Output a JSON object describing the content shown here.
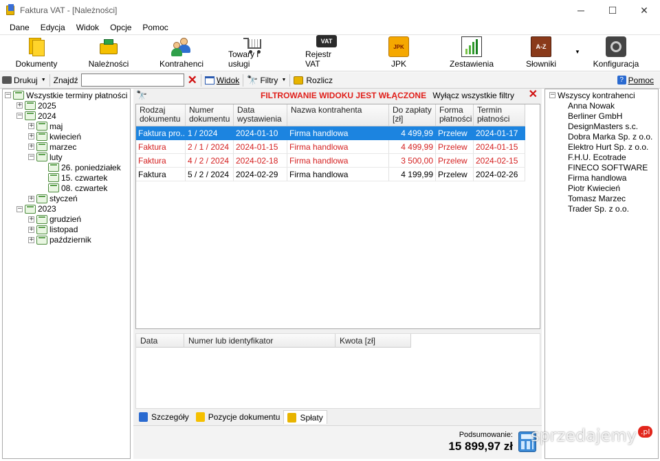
{
  "window": {
    "title": "Faktura VAT - [Należności]",
    "minimize": "─",
    "maximize": "☐",
    "close": "✕"
  },
  "menu": [
    {
      "label": "Dane"
    },
    {
      "label": "Edycja"
    },
    {
      "label": "Widok"
    },
    {
      "label": "Opcje"
    },
    {
      "label": "Pomoc"
    }
  ],
  "ribbon": [
    {
      "label": "Dokumenty",
      "icon": "documents-icon"
    },
    {
      "label": "Należności",
      "icon": "receivables-icon"
    },
    {
      "label": "Kontrahenci",
      "icon": "contractors-icon"
    },
    {
      "label": "Towary i usługi",
      "icon": "cart-icon"
    },
    {
      "label": "Rejestr VAT",
      "icon": "vat-register-icon",
      "icon_text": "VAT"
    },
    {
      "label": "JPK",
      "icon": "jpk-icon",
      "icon_text": "JPK"
    },
    {
      "label": "Zestawienia",
      "icon": "reports-icon"
    },
    {
      "label": "Słowniki",
      "icon": "dictionary-icon",
      "icon_text": "A-Z"
    },
    {
      "label": "Konfiguracja",
      "icon": "config-icon"
    }
  ],
  "toolbar": {
    "print": "Drukuj",
    "find": "Znajdź",
    "search_value": "",
    "view": "Widok",
    "filters": "Filtry",
    "settle": "Rozlicz",
    "help": "Pomoc"
  },
  "filter": {
    "status": "FILTROWANIE WIDOKU JEST WŁĄCZONE",
    "disable_all": "Wyłącz wszystkie filtry"
  },
  "left_tree": [
    {
      "label": "Wszystkie terminy płatności",
      "level": 0,
      "exp": "−"
    },
    {
      "label": "2025",
      "level": 1,
      "exp": "+"
    },
    {
      "label": "2024",
      "level": 1,
      "exp": "−"
    },
    {
      "label": "maj",
      "level": 2,
      "exp": "+"
    },
    {
      "label": "kwiecień",
      "level": 2,
      "exp": "+"
    },
    {
      "label": "marzec",
      "level": 2,
      "exp": "+"
    },
    {
      "label": "luty",
      "level": 2,
      "exp": "−"
    },
    {
      "label": "26. poniedziałek",
      "level": 3,
      "exp": ""
    },
    {
      "label": "15. czwartek",
      "level": 3,
      "exp": ""
    },
    {
      "label": "08. czwartek",
      "level": 3,
      "exp": ""
    },
    {
      "label": "styczeń",
      "level": 2,
      "exp": "+"
    },
    {
      "label": "2023",
      "level": 1,
      "exp": "−"
    },
    {
      "label": "grudzień",
      "level": 2,
      "exp": "+"
    },
    {
      "label": "listopad",
      "level": 2,
      "exp": "+"
    },
    {
      "label": "październik",
      "level": 2,
      "exp": "+"
    }
  ],
  "grid": {
    "columns": [
      {
        "label": "Rodzaj\ndokumentu"
      },
      {
        "label": "Numer\ndokumentu"
      },
      {
        "label": "Data\nwystawienia"
      },
      {
        "label": "Nazwa kontrahenta"
      },
      {
        "label": "Do zapłaty\n[zł]"
      },
      {
        "label": "Forma\npłatności"
      },
      {
        "label": "Termin\npłatności"
      }
    ],
    "rows": [
      {
        "type": "Faktura pro...",
        "number": "1 / 2024",
        "issued": "2024-01-10",
        "contractor": "Firma handlowa",
        "amount": "4 499,99",
        "payment": "Przelew",
        "due": "2024-01-17",
        "state": "selected"
      },
      {
        "type": "Faktura",
        "number": "2 / 1 / 2024",
        "issued": "2024-01-15",
        "contractor": "Firma handlowa",
        "amount": "4 499,99",
        "payment": "Przelew",
        "due": "2024-01-15",
        "state": "overdue"
      },
      {
        "type": "Faktura",
        "number": "4 / 2 / 2024",
        "issued": "2024-02-18",
        "contractor": "Firma handlowa",
        "amount": "3 500,00",
        "payment": "Przelew",
        "due": "2024-02-15",
        "state": "overdue"
      },
      {
        "type": "Faktura",
        "number": "5 / 2 / 2024",
        "issued": "2024-02-29",
        "contractor": "Firma handlowa",
        "amount": "4 199,99",
        "payment": "Przelew",
        "due": "2024-02-26",
        "state": "normal"
      }
    ]
  },
  "payments": {
    "columns": [
      {
        "label": "Data"
      },
      {
        "label": "Numer lub identyfikator"
      },
      {
        "label": "Kwota [zł]"
      }
    ]
  },
  "tabs": [
    {
      "label": "Szczegóły"
    },
    {
      "label": "Pozycje dokumentu"
    },
    {
      "label": "Spłaty",
      "active": true
    }
  ],
  "summary": {
    "label": "Podsumowanie:",
    "value": "15 899,97 zł"
  },
  "right_tree": {
    "root": "Wszyscy kontrahenci",
    "items": [
      "Anna Nowak",
      "Berliner GmbH",
      "DesignMasters s.c.",
      "Dobra Marka Sp. z o.o.",
      "Elektro Hurt Sp. z o.o.",
      "F.H.U. Ecotrade",
      "FINECO SOFTWARE",
      "Firma handlowa",
      "Piotr Kwiecień",
      "Tomasz Marzec",
      "Trader Sp. z o.o."
    ]
  },
  "watermark": {
    "text": "sprzedajemy",
    "badge": ".pl"
  },
  "colors": {
    "selected_bg": "#1c84e0",
    "overdue": "#d42020",
    "filter_text": "#e0201b"
  }
}
